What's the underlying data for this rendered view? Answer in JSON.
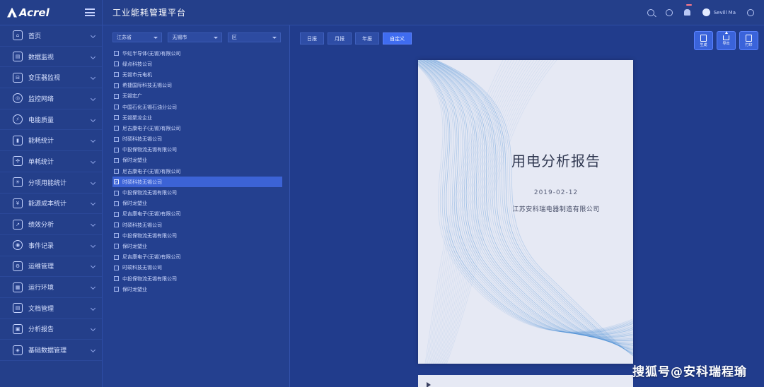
{
  "logo": {
    "text": "Acrel"
  },
  "header": {
    "title": "工业能耗管理平台",
    "notification_count": "",
    "user_name": "Sevill Ma"
  },
  "sidebar": {
    "items": [
      {
        "label": "首页",
        "icon": "home-icon"
      },
      {
        "label": "数据监视",
        "icon": "monitor-icon"
      },
      {
        "label": "变压器监视",
        "icon": "transformer-icon"
      },
      {
        "label": "监控网络",
        "icon": "network-icon"
      },
      {
        "label": "电能质量",
        "icon": "power-quality-icon"
      },
      {
        "label": "能耗统计",
        "icon": "bar-chart-icon"
      },
      {
        "label": "单耗统计",
        "icon": "nodes-icon"
      },
      {
        "label": "分项用能统计",
        "icon": "bulb-icon"
      },
      {
        "label": "能源成本统计",
        "icon": "yen-icon"
      },
      {
        "label": "绩效分析",
        "icon": "trend-icon"
      },
      {
        "label": "事件记录",
        "icon": "target-icon"
      },
      {
        "label": "运维管理",
        "icon": "tools-icon"
      },
      {
        "label": "运行环境",
        "icon": "environment-icon"
      },
      {
        "label": "文档管理",
        "icon": "document-icon"
      },
      {
        "label": "分析报告",
        "icon": "report-icon"
      },
      {
        "label": "基础数据管理",
        "icon": "database-icon"
      }
    ]
  },
  "filters": {
    "province": "江苏省",
    "city": "无锡市",
    "district": "区"
  },
  "companies": [
    {
      "name": "华虹半导体(无锡)有限公司",
      "checked": false
    },
    {
      "name": "绿点科技公司",
      "checked": false
    },
    {
      "name": "无锡市元电机",
      "checked": false
    },
    {
      "name": "希捷国际科技无锡公司",
      "checked": false
    },
    {
      "name": "无锡宏广",
      "checked": false
    },
    {
      "name": "中国石化无锡石油分公司",
      "checked": false
    },
    {
      "name": "无锡聚龙企业",
      "checked": false
    },
    {
      "name": "尼吉康电子(无锡)有限公司",
      "checked": false
    },
    {
      "name": "时硕科技无锡公司",
      "checked": false
    },
    {
      "name": "中投保物流无锡有限公司",
      "checked": false
    },
    {
      "name": "保时龙塑业",
      "checked": false
    },
    {
      "name": "尼吉康电子(无锡)有限公司",
      "checked": false
    },
    {
      "name": "时硕科技无锡公司",
      "checked": true
    },
    {
      "name": "中投保物流无锡有限公司",
      "checked": false
    },
    {
      "name": "保时龙塑业",
      "checked": false
    },
    {
      "name": "尼吉康电子(无锡)有限公司",
      "checked": false
    },
    {
      "name": "时硕科技无锡公司",
      "checked": false
    },
    {
      "name": "中投保物流无锡有限公司",
      "checked": false
    },
    {
      "name": "保时龙塑业",
      "checked": false
    },
    {
      "name": "尼吉康电子(无锡)有限公司",
      "checked": false
    },
    {
      "name": "时硕科技无锡公司",
      "checked": false
    },
    {
      "name": "中投保物流无锡有限公司",
      "checked": false
    },
    {
      "name": "保时龙塑业",
      "checked": false
    }
  ],
  "tabs": [
    {
      "label": "日报",
      "active": false
    },
    {
      "label": "月报",
      "active": false
    },
    {
      "label": "年报",
      "active": false
    },
    {
      "label": "自定义",
      "active": true
    }
  ],
  "toolbar": {
    "generate_label": "生成",
    "export_label": "导出",
    "print_label": "打印"
  },
  "report": {
    "title": "用电分析报告",
    "date": "2019-02-12",
    "company": "江苏安科瑞电器制造有限公司"
  },
  "watermark": "搜狐号@安科瑞程瑜",
  "colors": {
    "background": "#1f3a8c",
    "sidebar": "#243f8a",
    "accent": "#3f6cf0",
    "selected_row": "#3c63d6",
    "report_paper": "#e6e9f4",
    "wave": "#4a8fd6"
  }
}
